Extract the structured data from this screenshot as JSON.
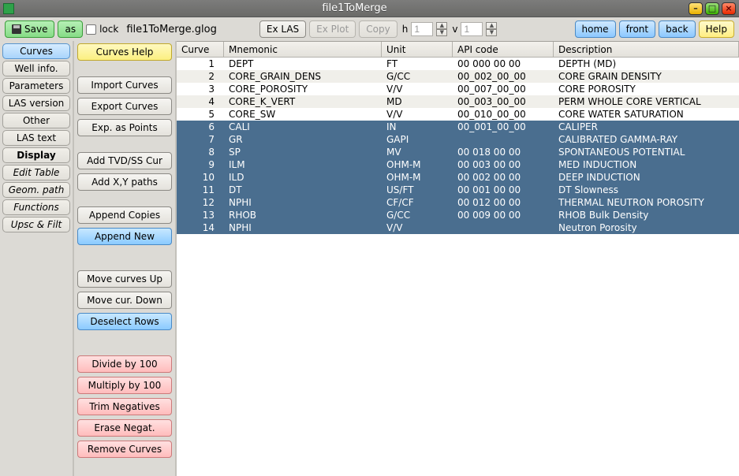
{
  "window_title": "file1ToMerge",
  "toolbar": {
    "save": "Save",
    "as": "as",
    "lock": "lock",
    "filename": "file1ToMerge.glog",
    "ex_las": "Ex LAS",
    "ex_plot": "Ex Plot",
    "copy": "Copy",
    "h_label": "h",
    "h_value": "1",
    "v_label": "v",
    "v_value": "1",
    "home": "home",
    "front": "front",
    "back": "back",
    "help": "Help"
  },
  "nav": [
    {
      "label": "Curves",
      "style": "active"
    },
    {
      "label": "Well info.",
      "style": ""
    },
    {
      "label": "Parameters",
      "style": ""
    },
    {
      "label": "LAS version",
      "style": ""
    },
    {
      "label": "Other",
      "style": ""
    },
    {
      "label": "LAS text",
      "style": ""
    },
    {
      "label": "Display",
      "style": "bold"
    },
    {
      "label": "Edit Table",
      "style": "italic"
    },
    {
      "label": "Geom. path",
      "style": "italic"
    },
    {
      "label": "Functions",
      "style": "italic"
    },
    {
      "label": "Upsc & Filt",
      "style": "italic"
    }
  ],
  "side": {
    "curves_help": "Curves Help",
    "import": "Import Curves",
    "export": "Export Curves",
    "exp_points": "Exp. as Points",
    "add_tvd": "Add TVD/SS Cur",
    "add_xy": "Add X,Y paths",
    "append_copies": "Append Copies",
    "append_new": "Append New",
    "move_up": "Move curves Up",
    "move_down": "Move cur. Down",
    "deselect": "Deselect Rows",
    "div100": "Divide by 100",
    "mul100": "Multiply by 100",
    "trim_neg": "Trim Negatives",
    "erase_neg": "Erase Negat.",
    "remove": "Remove Curves"
  },
  "table": {
    "headers": {
      "curve": "Curve",
      "mnemonic": "Mnemonic",
      "unit": "Unit",
      "api": "API code",
      "desc": "Description"
    },
    "rows": [
      {
        "idx": "1",
        "mnemonic": "DEPT",
        "unit": "FT",
        "api": "00 000 00 00",
        "desc": "DEPTH (MD)",
        "sel": false
      },
      {
        "idx": "2",
        "mnemonic": "CORE_GRAIN_DENS",
        "unit": "G/CC",
        "api": "00_002_00_00",
        "desc": "CORE GRAIN DENSITY",
        "sel": false
      },
      {
        "idx": "3",
        "mnemonic": "CORE_POROSITY",
        "unit": "V/V",
        "api": "00_007_00_00",
        "desc": "CORE POROSITY",
        "sel": false
      },
      {
        "idx": "4",
        "mnemonic": "CORE_K_VERT",
        "unit": "MD",
        "api": "00_003_00_00",
        "desc": "PERM WHOLE CORE VERTICAL",
        "sel": false
      },
      {
        "idx": "5",
        "mnemonic": "CORE_SW",
        "unit": "V/V",
        "api": "00_010_00_00",
        "desc": "CORE WATER SATURATION",
        "sel": false
      },
      {
        "idx": "6",
        "mnemonic": "CALI",
        "unit": "IN",
        "api": "00_001_00_00",
        "desc": "CALIPER",
        "sel": true
      },
      {
        "idx": "7",
        "mnemonic": "GR",
        "unit": "GAPI",
        "api": "",
        "desc": "CALIBRATED GAMMA-RAY",
        "sel": true
      },
      {
        "idx": "8",
        "mnemonic": "SP",
        "unit": "MV",
        "api": "00 018 00 00",
        "desc": "SPONTANEOUS POTENTIAL",
        "sel": true
      },
      {
        "idx": "9",
        "mnemonic": "ILM",
        "unit": "OHM-M",
        "api": "00 003 00 00",
        "desc": "MED INDUCTION",
        "sel": true
      },
      {
        "idx": "10",
        "mnemonic": "ILD",
        "unit": "OHM-M",
        "api": "00 002 00 00",
        "desc": "DEEP INDUCTION",
        "sel": true
      },
      {
        "idx": "11",
        "mnemonic": "DT",
        "unit": "US/FT",
        "api": "00 001 00 00",
        "desc": "DT Slowness",
        "sel": true
      },
      {
        "idx": "12",
        "mnemonic": "NPHI",
        "unit": "CF/CF",
        "api": "00 012 00 00",
        "desc": "THERMAL NEUTRON POROSITY",
        "sel": true
      },
      {
        "idx": "13",
        "mnemonic": "RHOB",
        "unit": "G/CC",
        "api": "00 009 00 00",
        "desc": "RHOB Bulk Density",
        "sel": true
      },
      {
        "idx": "14",
        "mnemonic": "NPHI",
        "unit": "V/V",
        "api": "",
        "desc": "Neutron Porosity",
        "sel": true
      }
    ]
  }
}
